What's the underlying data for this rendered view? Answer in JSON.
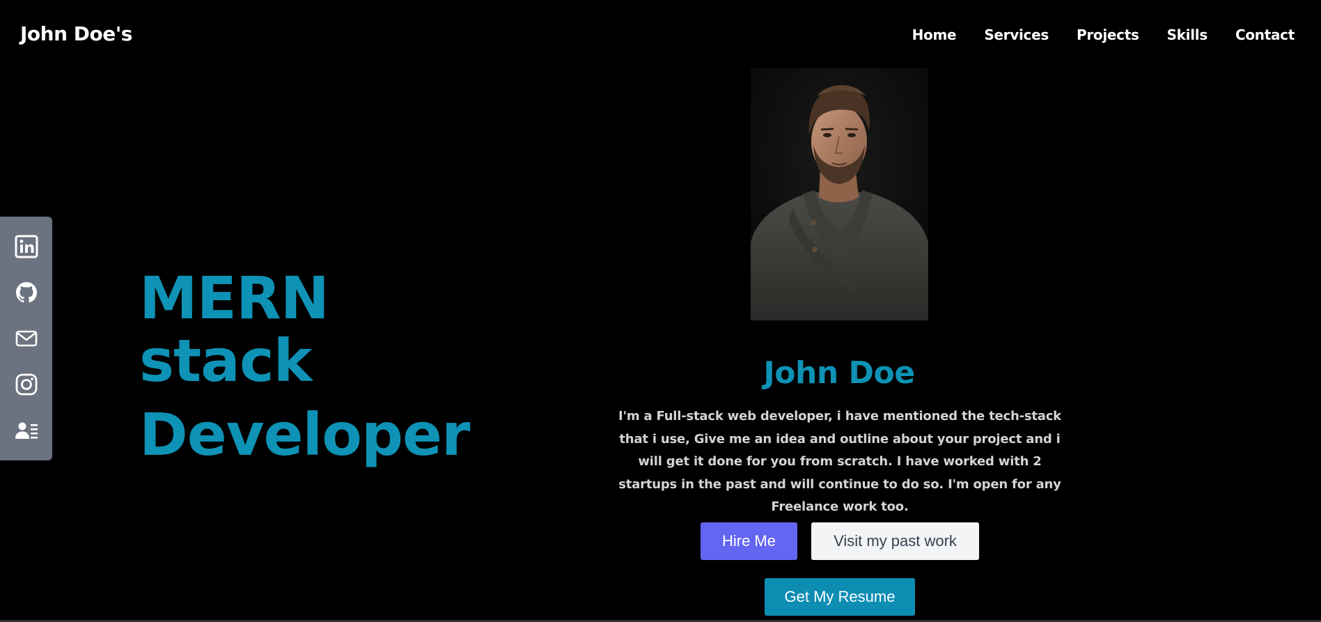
{
  "brand": "John Doe's",
  "nav": {
    "items": [
      "Home",
      "Services",
      "Projects",
      "Skills",
      "Contact"
    ]
  },
  "social": {
    "icons": [
      "linkedin-icon",
      "github-icon",
      "mail-icon",
      "instagram-icon",
      "resume-user-icon"
    ]
  },
  "hero": {
    "line1": "MERN",
    "line2": "stack",
    "line3": "Developer"
  },
  "profile": {
    "name": "John Doe",
    "bio": "I'm a Full-stack web developer, i have mentioned the tech-stack that i use, Give me an idea and outline about your project and i will get it done for you from scratch. I have worked with 2 startups in the past and will continue to do so. I'm open for any Freelance work too."
  },
  "buttons": {
    "hire": "Hire Me",
    "work": "Visit my past work",
    "resume": "Get My Resume"
  },
  "colors": {
    "background": "#000000",
    "accent": "#0e92b5",
    "hire_button": "#6366f1",
    "work_button": "#f3f4f6",
    "resume_button": "#0e8db3",
    "social_bar": "#6b7280"
  }
}
